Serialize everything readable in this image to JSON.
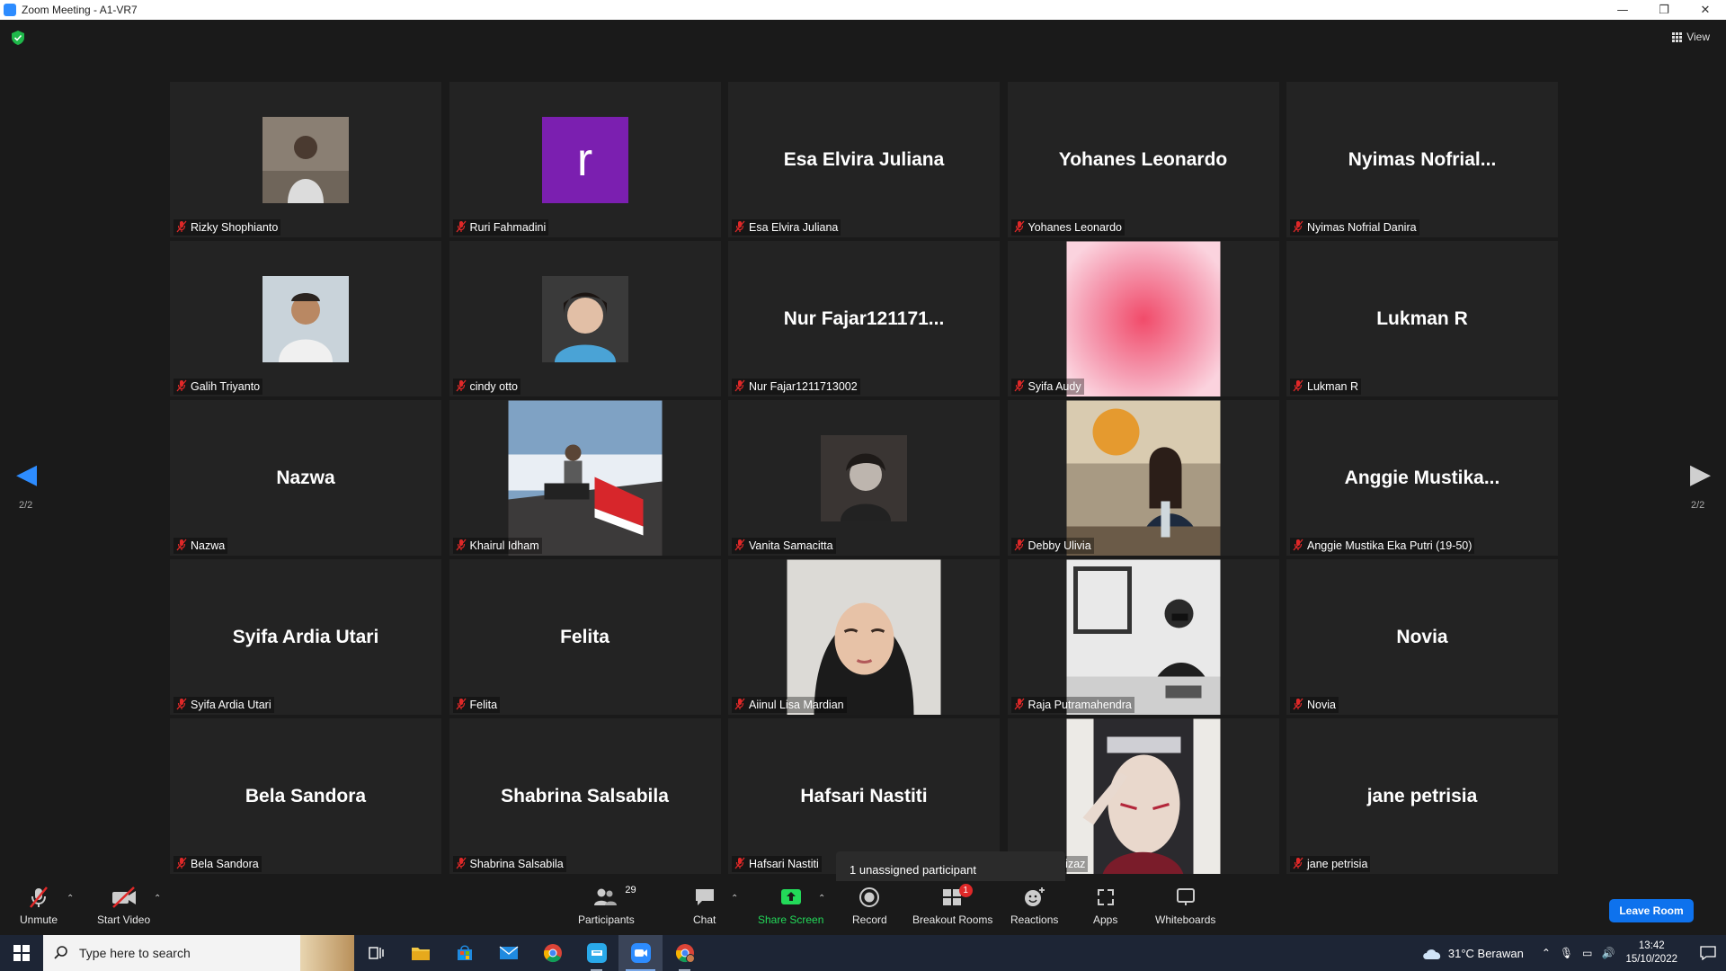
{
  "window": {
    "title": "Zoom Meeting - A1-VR7",
    "controls": [
      "—",
      "❐",
      "✕"
    ]
  },
  "view_label": "View",
  "page_indicator": {
    "left": "2/2",
    "right": "2/2"
  },
  "tiles": [
    {
      "name": "Rizky Shophianto",
      "display": "photo",
      "photo": "rizky",
      "big": ""
    },
    {
      "name": "Ruri Fahmadini",
      "display": "letter",
      "letter": "r",
      "big": ""
    },
    {
      "name": "Esa Elvira Juliana",
      "display": "text",
      "big": "Esa Elvira Juliana"
    },
    {
      "name": "Yohanes Leonardo",
      "display": "text",
      "big": "Yohanes Leonardo"
    },
    {
      "name": "Nyimas Nofrial Danira",
      "display": "text",
      "big": "Nyimas  Nofrial..."
    },
    {
      "name": "Galih Triyanto",
      "display": "photo",
      "photo": "galih",
      "big": ""
    },
    {
      "name": "cindy otto",
      "display": "photo",
      "photo": "cindy",
      "big": ""
    },
    {
      "name": "Nur Fajar1211713002",
      "display": "text",
      "big": "Nur  Fajar121171..."
    },
    {
      "name": "Syifa Audy",
      "display": "photo",
      "photo": "syifa",
      "big": ""
    },
    {
      "name": "Lukman R",
      "display": "text",
      "big": "Lukman R"
    },
    {
      "name": "Nazwa",
      "display": "text",
      "big": "Nazwa"
    },
    {
      "name": "Khairul Idham",
      "display": "photo",
      "photo": "khairul",
      "big": ""
    },
    {
      "name": "Vanita Samacitta",
      "display": "photo",
      "photo": "vanita",
      "big": ""
    },
    {
      "name": "Debby Ulivia",
      "display": "photo",
      "photo": "debby",
      "big": ""
    },
    {
      "name": "Anggie Mustika Eka Putri (19-50)",
      "display": "text",
      "big": "Anggie  Mustika..."
    },
    {
      "name": "Syifa Ardia Utari",
      "display": "text",
      "big": "Syifa Ardia Utari"
    },
    {
      "name": "Felita",
      "display": "text",
      "big": "Felita"
    },
    {
      "name": "Aiinul Lisa Mardian",
      "display": "photo",
      "photo": "aiinul",
      "big": ""
    },
    {
      "name": "Raja Putramahendra",
      "display": "photo",
      "photo": "raja",
      "big": ""
    },
    {
      "name": "Novia",
      "display": "text",
      "big": "Novia"
    },
    {
      "name": "Bela Sandora",
      "display": "text",
      "big": "Bela Sandora"
    },
    {
      "name": "Shabrina Salsabila",
      "display": "text",
      "big": "Shabrina Salsabila"
    },
    {
      "name": "Hafsari Nastiti",
      "display": "text",
      "big": "Hafsari Nastiti"
    },
    {
      "name": "arif al-hizaz",
      "display": "photo",
      "photo": "arif",
      "big": ""
    },
    {
      "name": "jane petrisia",
      "display": "text",
      "big": "jane petrisia"
    }
  ],
  "tooltip": "1 unassigned participant",
  "toolbar": {
    "unmute": "Unmute",
    "start_video": "Start Video",
    "participants": "Participants",
    "participants_count": "29",
    "chat": "Chat",
    "share_screen": "Share Screen",
    "record": "Record",
    "breakout_rooms": "Breakout Rooms",
    "breakout_badge": "1",
    "reactions": "Reactions",
    "apps": "Apps",
    "whiteboards": "Whiteboards",
    "leave": "Leave Room"
  },
  "taskbar": {
    "search_placeholder": "Type here to search",
    "weather": "31°C  Berawan",
    "time": "13:42",
    "date": "15/10/2022"
  },
  "colors": {
    "accent": "#0e72ed",
    "share_green": "#23d959",
    "mute_red": "#e02828",
    "avatar_purple": "#7b1fb0"
  }
}
